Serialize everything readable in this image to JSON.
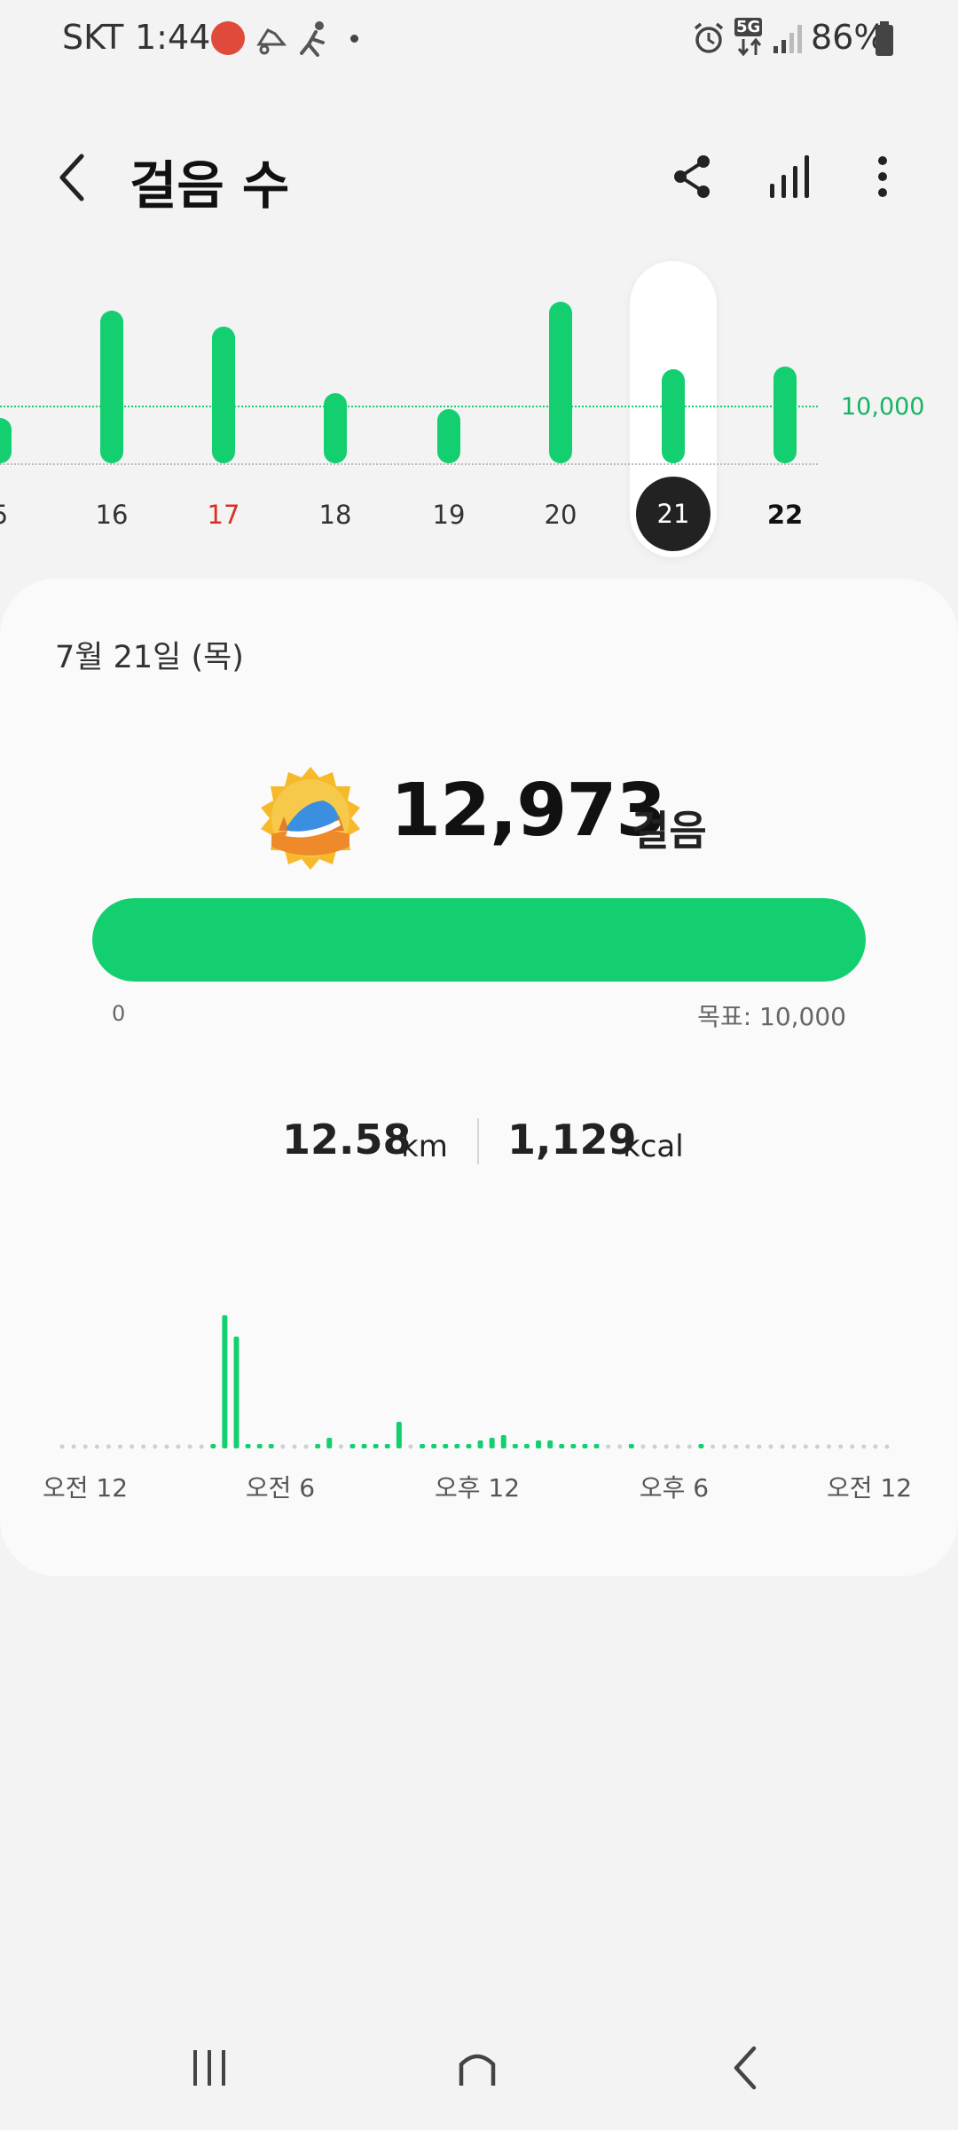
{
  "status_bar": {
    "carrier": "SKT",
    "time": "1:44",
    "notif_icons": [
      "app-notification-icon",
      "running-shoes-icon",
      "runner-icon",
      "dot-icon"
    ],
    "right_icons": [
      "alarm-icon",
      "5g-data-icon",
      "signal-icon",
      "battery-icon"
    ],
    "network": "5G",
    "battery": "86%"
  },
  "app_bar": {
    "title": "걸음 수",
    "actions": [
      "share-icon",
      "bar-chart-icon",
      "more-vert-icon"
    ]
  },
  "weekly_chart": {
    "goal_label": "10,000",
    "selected_day": "21",
    "today_label": "22",
    "days": [
      {
        "label": "5",
        "steps": 9000
      },
      {
        "label": "16",
        "steps": 17800
      },
      {
        "label": "17",
        "steps": 16500,
        "holiday": true
      },
      {
        "label": "18",
        "steps": 11000
      },
      {
        "label": "19",
        "steps": 9700
      },
      {
        "label": "20",
        "steps": 18500
      },
      {
        "label": "21",
        "steps": 12973,
        "selected": true
      },
      {
        "label": "22",
        "steps": 13200,
        "today": true
      }
    ],
    "colors": {
      "bar": "#14cf6f",
      "holiday": "#d93025"
    }
  },
  "summary": {
    "date": "7월 21일 (목)",
    "steps": "12,973",
    "steps_unit": "걸음",
    "badge_icon": "shoe-achievement-badge-icon",
    "progress_fraction": 1.0,
    "progress_min": "0",
    "goal": "목표: 10,000",
    "distance": "12.58",
    "distance_unit": "km",
    "calories": "1,129",
    "calories_unit": "kcal"
  },
  "hourly_chart": {
    "time_labels": [
      "오전 12",
      "오전 6",
      "오후 12",
      "오후 6",
      "오전 12"
    ],
    "values": [
      0,
      0,
      0,
      0,
      0,
      0,
      0,
      0,
      0,
      0,
      0,
      0,
      0,
      3,
      100,
      84,
      3,
      3,
      3,
      0,
      0,
      0,
      3,
      8,
      0,
      3,
      3,
      3,
      3,
      20,
      0,
      3,
      3,
      3,
      3,
      3,
      6,
      8,
      10,
      3,
      3,
      6,
      6,
      3,
      3,
      3,
      3,
      0,
      0,
      3,
      0,
      0,
      0,
      0,
      0,
      3,
      0,
      0,
      0,
      0,
      0,
      0,
      0,
      0,
      0,
      0,
      0,
      0,
      0,
      0,
      0,
      0
    ]
  },
  "nav_bar": {
    "icons": [
      "recent-apps-icon",
      "home-icon",
      "back-icon"
    ]
  }
}
